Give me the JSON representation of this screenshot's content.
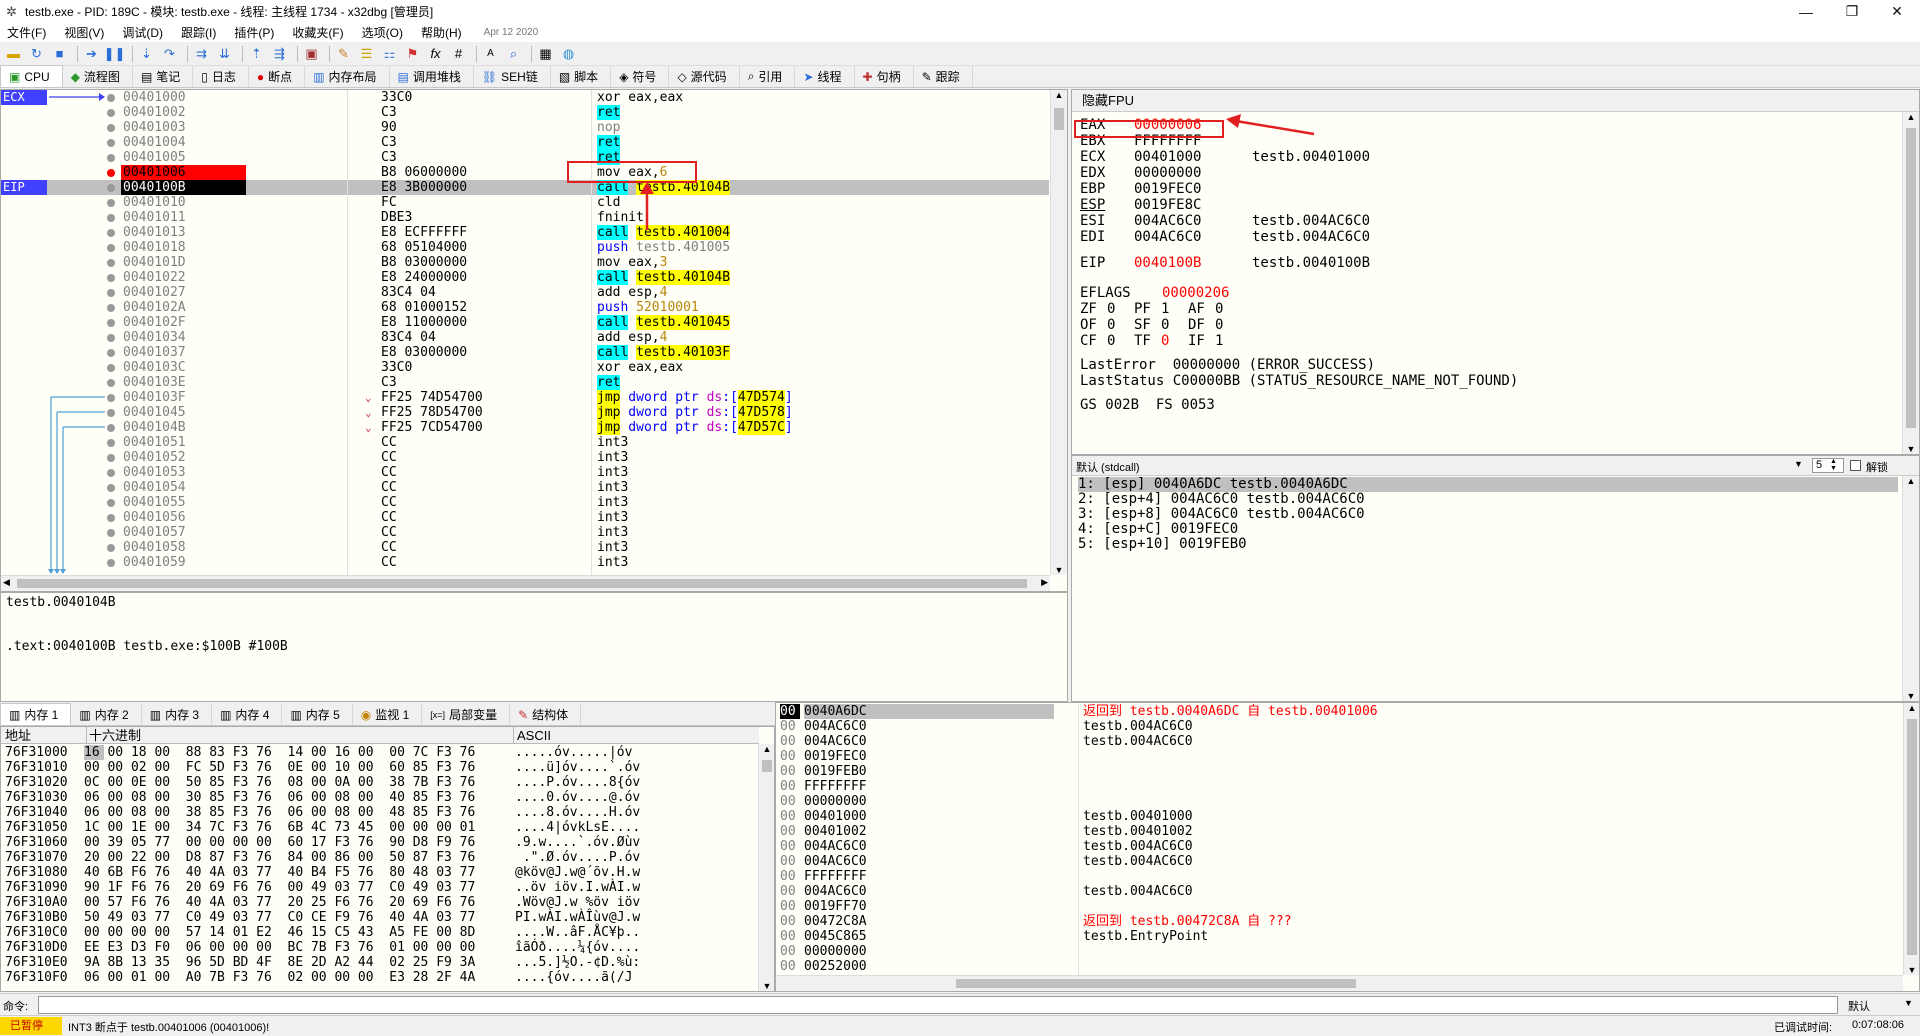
{
  "window": {
    "title": "testb.exe - PID: 189C - 模块: testb.exe - 线程: 主线程 1734 - x32dbg [管理员]"
  },
  "menu": {
    "items": [
      "文件(F)",
      "视图(V)",
      "调试(D)",
      "跟踪(I)",
      "插件(P)",
      "收藏夹(F)",
      "选项(O)",
      "帮助(H)"
    ],
    "date": "Apr 12 2020"
  },
  "tabs": [
    {
      "label": "CPU",
      "icon": "cpu-icon"
    },
    {
      "label": "流程图",
      "icon": "graph-icon"
    },
    {
      "label": "笔记",
      "icon": "notes-icon"
    },
    {
      "label": "日志",
      "icon": "log-icon"
    },
    {
      "label": "断点",
      "icon": "breakpoint-icon"
    },
    {
      "label": "内存布局",
      "icon": "memory-map-icon"
    },
    {
      "label": "调用堆栈",
      "icon": "callstack-icon"
    },
    {
      "label": "SEH链",
      "icon": "seh-icon"
    },
    {
      "label": "脚本",
      "icon": "script-icon"
    },
    {
      "label": "符号",
      "icon": "symbols-icon"
    },
    {
      "label": "源代码",
      "icon": "source-icon"
    },
    {
      "label": "引用",
      "icon": "references-icon"
    },
    {
      "label": "线程",
      "icon": "threads-icon"
    },
    {
      "label": "句柄",
      "icon": "handles-icon"
    },
    {
      "label": "跟踪",
      "icon": "trace-icon"
    }
  ],
  "cpu": {
    "reg_labels": {
      "ecx": "ECX",
      "eip": "EIP"
    },
    "rows": [
      {
        "addr": "00401000",
        "bytes": "33C0",
        "ins": [
          {
            "t": "xor eax,eax"
          }
        ]
      },
      {
        "addr": "00401002",
        "bytes": "C3",
        "ins": [
          {
            "t": "ret",
            "c": "ret"
          }
        ]
      },
      {
        "addr": "00401003",
        "bytes": "90",
        "ins": [
          {
            "t": "nop",
            "c": "grey"
          }
        ]
      },
      {
        "addr": "00401004",
        "bytes": "C3",
        "ins": [
          {
            "t": "ret",
            "c": "ret"
          }
        ]
      },
      {
        "addr": "00401005",
        "bytes": "C3",
        "ins": [
          {
            "t": "ret",
            "c": "ret"
          }
        ]
      },
      {
        "addr": "00401006",
        "bytes": "B8 06000000",
        "ins": [
          {
            "t": "mov eax,"
          },
          {
            "t": "6",
            "c": "gold"
          }
        ],
        "bp": true
      },
      {
        "addr": "0040100B",
        "bytes": "E8 3B000000",
        "ins": [
          {
            "t": "call",
            "c": "call"
          },
          {
            "t": " "
          },
          {
            "t": "testb.40104B",
            "c": "addr"
          }
        ],
        "eip": true
      },
      {
        "addr": "00401010",
        "bytes": "FC",
        "ins": [
          {
            "t": "cld"
          }
        ]
      },
      {
        "addr": "00401011",
        "bytes": "DBE3",
        "ins": [
          {
            "t": "fninit"
          }
        ]
      },
      {
        "addr": "00401013",
        "bytes": "E8 ECFFFFFF",
        "ins": [
          {
            "t": "call",
            "c": "call"
          },
          {
            "t": " "
          },
          {
            "t": "testb.401004",
            "c": "addr"
          }
        ]
      },
      {
        "addr": "00401018",
        "bytes": "68 05104000",
        "ins": [
          {
            "t": "push",
            "c": "blue"
          },
          {
            "t": " testb.401005",
            "c": "grey"
          }
        ]
      },
      {
        "addr": "0040101D",
        "bytes": "B8 03000000",
        "ins": [
          {
            "t": "mov eax,"
          },
          {
            "t": "3",
            "c": "gold"
          }
        ]
      },
      {
        "addr": "00401022",
        "bytes": "E8 24000000",
        "ins": [
          {
            "t": "call",
            "c": "call"
          },
          {
            "t": " "
          },
          {
            "t": "testb.40104B",
            "c": "addr"
          }
        ]
      },
      {
        "addr": "00401027",
        "bytes": "83C4 04",
        "ins": [
          {
            "t": "add esp,"
          },
          {
            "t": "4",
            "c": "gold"
          }
        ]
      },
      {
        "addr": "0040102A",
        "bytes": "68 01000152",
        "ins": [
          {
            "t": "push",
            "c": "blue"
          },
          {
            "t": " 52010001",
            "c": "gold"
          }
        ]
      },
      {
        "addr": "0040102F",
        "bytes": "E8 11000000",
        "ins": [
          {
            "t": "call",
            "c": "call"
          },
          {
            "t": " "
          },
          {
            "t": "testb.401045",
            "c": "addr"
          }
        ]
      },
      {
        "addr": "00401034",
        "bytes": "83C4 04",
        "ins": [
          {
            "t": "add esp,"
          },
          {
            "t": "4",
            "c": "gold"
          }
        ]
      },
      {
        "addr": "00401037",
        "bytes": "E8 03000000",
        "ins": [
          {
            "t": "call",
            "c": "call"
          },
          {
            "t": " "
          },
          {
            "t": "testb.40103F",
            "c": "addr"
          }
        ]
      },
      {
        "addr": "0040103C",
        "bytes": "33C0",
        "ins": [
          {
            "t": "xor eax,eax"
          }
        ]
      },
      {
        "addr": "0040103E",
        "bytes": "C3",
        "ins": [
          {
            "t": "ret",
            "c": "ret"
          }
        ]
      },
      {
        "addr": "0040103F",
        "bytes": "FF25 74D54700",
        "ins": [
          {
            "t": "jmp",
            "c": "jmp"
          },
          {
            "t": " dword ptr ",
            "c": "blue"
          },
          {
            "t": "ds",
            "c": "mag"
          },
          {
            "t": ":",
            "c": "blue"
          },
          {
            "t": "[",
            "c": "blue"
          },
          {
            "t": "47D574",
            "c": "addr"
          },
          {
            "t": "]",
            "c": "blue"
          }
        ],
        "mark": "⌄"
      },
      {
        "addr": "00401045",
        "bytes": "FF25 78D54700",
        "ins": [
          {
            "t": "jmp",
            "c": "jmp"
          },
          {
            "t": " dword ptr ",
            "c": "blue"
          },
          {
            "t": "ds",
            "c": "mag"
          },
          {
            "t": ":",
            "c": "blue"
          },
          {
            "t": "[",
            "c": "blue"
          },
          {
            "t": "47D578",
            "c": "addr"
          },
          {
            "t": "]",
            "c": "blue"
          }
        ],
        "mark": "⌄"
      },
      {
        "addr": "0040104B",
        "bytes": "FF25 7CD54700",
        "ins": [
          {
            "t": "jmp",
            "c": "jmp"
          },
          {
            "t": " dword ptr ",
            "c": "blue"
          },
          {
            "t": "ds",
            "c": "mag"
          },
          {
            "t": ":",
            "c": "blue"
          },
          {
            "t": "[",
            "c": "blue"
          },
          {
            "t": "47D57C",
            "c": "addr"
          },
          {
            "t": "]",
            "c": "blue"
          }
        ],
        "mark": "⌄"
      },
      {
        "addr": "00401051",
        "bytes": "CC",
        "ins": [
          {
            "t": "int3"
          }
        ]
      },
      {
        "addr": "00401052",
        "bytes": "CC",
        "ins": [
          {
            "t": "int3"
          }
        ]
      },
      {
        "addr": "00401053",
        "bytes": "CC",
        "ins": [
          {
            "t": "int3"
          }
        ]
      },
      {
        "addr": "00401054",
        "bytes": "CC",
        "ins": [
          {
            "t": "int3"
          }
        ]
      },
      {
        "addr": "00401055",
        "bytes": "CC",
        "ins": [
          {
            "t": "int3"
          }
        ]
      },
      {
        "addr": "00401056",
        "bytes": "CC",
        "ins": [
          {
            "t": "int3"
          }
        ]
      },
      {
        "addr": "00401057",
        "bytes": "CC",
        "ins": [
          {
            "t": "int3"
          }
        ]
      },
      {
        "addr": "00401058",
        "bytes": "CC",
        "ins": [
          {
            "t": "int3"
          }
        ]
      },
      {
        "addr": "00401059",
        "bytes": "CC",
        "ins": [
          {
            "t": "int3"
          }
        ]
      }
    ]
  },
  "info": {
    "line1": "testb.0040104B",
    "line2": ".text:0040100B testb.exe:$100B #100B"
  },
  "registers": {
    "header": "隐藏FPU",
    "gp": [
      {
        "name": "EAX",
        "val": "00000006",
        "red": true,
        "sym": ""
      },
      {
        "name": "EBX",
        "val": "FFFFFFFF",
        "sym": ""
      },
      {
        "name": "ECX",
        "val": "00401000",
        "sym": "testb.00401000"
      },
      {
        "name": "EDX",
        "val": "00000000",
        "sym": ""
      },
      {
        "name": "EBP",
        "val": "0019FEC0",
        "sym": ""
      },
      {
        "name": "ESP",
        "val": "0019FE8C",
        "sym": ""
      },
      {
        "name": "ESI",
        "val": "004AC6C0",
        "sym": "testb.004AC6C0"
      },
      {
        "name": "EDI",
        "val": "004AC6C0",
        "sym": "testb.004AC6C0"
      }
    ],
    "eip": {
      "name": "EIP",
      "val": "0040100B",
      "sym": "testb.0040100B"
    },
    "eflags": {
      "name": "EFLAGS",
      "val": "00000206"
    },
    "flags": [
      [
        {
          "n": "ZF",
          "v": "0"
        },
        {
          "n": "PF",
          "v": "1"
        },
        {
          "n": "AF",
          "v": "0"
        }
      ],
      [
        {
          "n": "OF",
          "v": "0"
        },
        {
          "n": "SF",
          "v": "0"
        },
        {
          "n": "DF",
          "v": "0"
        }
      ],
      [
        {
          "n": "CF",
          "v": "0"
        },
        {
          "n": "TF",
          "v": "0",
          "red": true
        },
        {
          "n": "IF",
          "v": "1"
        }
      ]
    ],
    "lasterror": "LastError  00000000 (ERROR_SUCCESS)",
    "laststatus": "LastStatus C00000BB (STATUS_RESOURCE_NAME_NOT_FOUND)",
    "segs": "GS 002B  FS 0053"
  },
  "callstack": {
    "convention": "默认 (stdcall)",
    "count": "5",
    "unlock_label": "解锁",
    "rows": [
      "1: [esp] 0040A6DC testb.0040A6DC",
      "2: [esp+4] 004AC6C0 testb.004AC6C0",
      "3: [esp+8] 004AC6C0 testb.004AC6C0",
      "4: [esp+C] 0019FEC0",
      "5: [esp+10] 0019FEB0"
    ]
  },
  "dump_tabs": [
    {
      "label": "内存 1",
      "icon": "memory-icon"
    },
    {
      "label": "内存 2",
      "icon": "memory-icon"
    },
    {
      "label": "内存 3",
      "icon": "memory-icon"
    },
    {
      "label": "内存 4",
      "icon": "memory-icon"
    },
    {
      "label": "内存 5",
      "icon": "memory-icon"
    },
    {
      "label": "监视 1",
      "icon": "watch-icon"
    },
    {
      "label": "局部变量",
      "icon": "locals-icon"
    },
    {
      "label": "结构体",
      "icon": "struct-icon"
    }
  ],
  "dump": {
    "headers": {
      "addr": "地址",
      "hex": "十六进制",
      "ascii": "ASCII"
    },
    "rows": [
      {
        "a": "76F31000",
        "h": "16 00 18 00  88 83 F3 76  14 00 16 00  00 7C F3 76",
        "c": ".....óv.....|óv"
      },
      {
        "a": "76F31010",
        "h": "00 00 02 00  FC 5D F3 76  0E 00 10 00  60 85 F3 76",
        "c": "....ü]óv....`.óv"
      },
      {
        "a": "76F31020",
        "h": "0C 00 0E 00  50 85 F3 76  08 00 0A 00  38 7B F3 76",
        "c": "....P.óv....8{óv"
      },
      {
        "a": "76F31030",
        "h": "06 00 08 00  30 85 F3 76  06 00 08 00  40 85 F3 76",
        "c": "....0.óv....@.óv"
      },
      {
        "a": "76F31040",
        "h": "06 00 08 00  38 85 F3 76  06 00 08 00  48 85 F3 76",
        "c": "....8.óv....H.óv"
      },
      {
        "a": "76F31050",
        "h": "1C 00 1E 00  34 7C F3 76  6B 4C 73 45  00 00 00 01",
        "c": "....4|óvkLsE...."
      },
      {
        "a": "76F31060",
        "h": "00 39 05 77  00 00 00 00  60 17 F3 76  90 D8 F9 76",
        "c": ".9.w....`.óv.Øùv"
      },
      {
        "a": "76F31070",
        "h": "20 00 22 00  D8 87 F3 76  84 00 86 00  50 87 F3 76",
        "c": " .\".Ø.óv....P.óv"
      },
      {
        "a": "76F31080",
        "h": "40 6B F6 76  40 4A 03 77  40 B4 F5 76  80 48 03 77",
        "c": "@köv@J.w@´õv.H.w"
      },
      {
        "a": "76F31090",
        "h": "90 1F F6 76  20 69 F6 76  00 49 03 77  C0 49 03 77",
        "c": "..öv iöv.I.wÀI.w"
      },
      {
        "a": "76F310A0",
        "h": "00 57 F6 76  40 4A 03 77  20 25 F6 76  20 69 F6 76",
        "c": ".Wöv@J.w %öv iöv"
      },
      {
        "a": "76F310B0",
        "h": "50 49 03 77  C0 49 03 77  C0 CE F9 76  40 4A 03 77",
        "c": "PI.wÀI.wÀÎùv@J.w"
      },
      {
        "a": "76F310C0",
        "h": "00 00 00 00  57 14 01 E2  46 15 C5 43  A5 FE 00 8D",
        "c": "....W..âF.ÅC¥þ.."
      },
      {
        "a": "76F310D0",
        "h": "EE E3 D3 F0  06 00 00 00  BC 7B F3 76  01 00 00 00",
        "c": "îãÓð....¼{óv...."
      },
      {
        "a": "76F310E0",
        "h": "9A 8B 13 35  96 5D BD 4F  8E 2D A2 44  02 25 F9 3A",
        "c": "...5.]½O.-¢D.%ù:"
      },
      {
        "a": "76F310F0",
        "h": "06 00 01 00  A0 7B F3 76  02 00 00 00  E3 28 2F 4A",
        "c": "....{óv....ã(/J"
      }
    ]
  },
  "stack": {
    "rows": [
      {
        "p": "00",
        "v": "0040A6DC",
        "c": "返回到 testb.0040A6DC 自 testb.00401006",
        "red": true,
        "top": true
      },
      {
        "p": "00",
        "v": "004AC6C0",
        "c": "testb.004AC6C0"
      },
      {
        "p": "00",
        "v": "004AC6C0",
        "c": "testb.004AC6C0"
      },
      {
        "p": "00",
        "v": "0019FEC0",
        "c": ""
      },
      {
        "p": "00",
        "v": "0019FEB0",
        "c": ""
      },
      {
        "p": "00",
        "v": "FFFFFFFF",
        "c": ""
      },
      {
        "p": "00",
        "v": "00000000",
        "c": ""
      },
      {
        "p": "00",
        "v": "00401000",
        "c": "testb.00401000"
      },
      {
        "p": "00",
        "v": "00401002",
        "c": "testb.00401002"
      },
      {
        "p": "00",
        "v": "004AC6C0",
        "c": "testb.004AC6C0"
      },
      {
        "p": "00",
        "v": "004AC6C0",
        "c": "testb.004AC6C0"
      },
      {
        "p": "00",
        "v": "FFFFFFFF",
        "c": ""
      },
      {
        "p": "00",
        "v": "004AC6C0",
        "c": "testb.004AC6C0"
      },
      {
        "p": "00",
        "v": "0019FF70",
        "c": ""
      },
      {
        "p": "00",
        "v": "00472C8A",
        "c": "返回到 testb.00472C8A 自 ???",
        "red": true
      },
      {
        "p": "00",
        "v": "0045C865",
        "c": "testb.EntryPoint"
      },
      {
        "p": "00",
        "v": "00000000",
        "c": ""
      },
      {
        "p": "00",
        "v": "00252000",
        "c": ""
      }
    ]
  },
  "cmd": {
    "label": "命令:",
    "value": "",
    "mode": "默认"
  },
  "status": {
    "state": "已暂停",
    "message": "INT3 断点于 testb.00401006 (00401006)!",
    "time_label": "已调试时间:",
    "time": "0:07:08:06"
  },
  "colors": {
    "bp": "#ff0000",
    "eip_bg": "#000000",
    "highlight_cyan": "#00ffff",
    "highlight_yellow": "#ffff00",
    "annotation": "#ff0000"
  }
}
